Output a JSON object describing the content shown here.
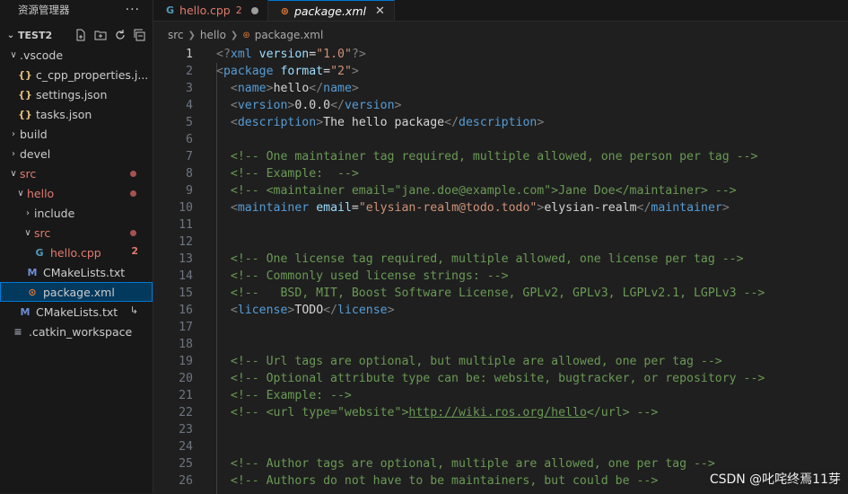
{
  "sidebar": {
    "header_title": "资源管理器",
    "more_label": "···",
    "section_title": "TEST2",
    "tree": [
      {
        "label": "v .vscode",
        "name": ".vscode",
        "type": "folder",
        "open": true,
        "depth": 0
      },
      {
        "label": "c_cpp_properties.j...",
        "type": "json",
        "depth": 1
      },
      {
        "label": "settings.json",
        "type": "json",
        "depth": 1
      },
      {
        "label": "tasks.json",
        "type": "json",
        "depth": 1
      },
      {
        "label": "build",
        "type": "folder",
        "open": false,
        "depth": 0
      },
      {
        "label": "devel",
        "type": "folder",
        "open": false,
        "depth": 0
      },
      {
        "label": "src",
        "type": "folder",
        "open": true,
        "depth": 0,
        "dot": true,
        "red": true
      },
      {
        "label": "hello",
        "type": "folder",
        "open": true,
        "depth": 1,
        "dot": true,
        "red": true
      },
      {
        "label": "include",
        "type": "folder",
        "open": false,
        "depth": 2
      },
      {
        "label": "src",
        "type": "folder",
        "open": true,
        "depth": 2,
        "dot": true,
        "red": true
      },
      {
        "label": "hello.cpp",
        "type": "cpp",
        "depth": 3,
        "badge": "2",
        "red": true
      },
      {
        "label": "CMakeLists.txt",
        "type": "cmake",
        "depth": 2
      },
      {
        "label": "package.xml",
        "type": "xml",
        "depth": 2,
        "selected": true
      },
      {
        "label": "CMakeLists.txt",
        "type": "cmake",
        "depth": 1,
        "link": "↳"
      },
      {
        "label": ".catkin_workspace",
        "type": "list",
        "depth": 0
      }
    ]
  },
  "tabs": [
    {
      "label": "hello.cpp",
      "icon": "G",
      "count": "2",
      "active": false,
      "dirty": true
    },
    {
      "label": "package.xml",
      "icon": "х",
      "active": true
    }
  ],
  "breadcrumb": [
    "src",
    "hello",
    "package.xml"
  ],
  "editor": {
    "current_line": 1,
    "lines": [
      {
        "n": "1",
        "tokens": [
          [
            "brk",
            "<?"
          ],
          [
            "tag",
            "xml"
          ],
          [
            "txt",
            " "
          ],
          [
            "attr",
            "version"
          ],
          [
            "txt",
            "="
          ],
          [
            "str",
            "\"1.0\""
          ],
          [
            "brk",
            "?>"
          ]
        ]
      },
      {
        "n": "2",
        "tokens": [
          [
            "brk",
            "<"
          ],
          [
            "tag",
            "package"
          ],
          [
            "txt",
            " "
          ],
          [
            "attr",
            "format"
          ],
          [
            "txt",
            "="
          ],
          [
            "str",
            "\"2\""
          ],
          [
            "brk",
            ">"
          ]
        ]
      },
      {
        "n": "3",
        "tokens": [
          [
            "txt",
            "  "
          ],
          [
            "brk",
            "<"
          ],
          [
            "tag",
            "name"
          ],
          [
            "brk",
            ">"
          ],
          [
            "txt",
            "hello"
          ],
          [
            "brk",
            "</"
          ],
          [
            "tag",
            "name"
          ],
          [
            "brk",
            ">"
          ]
        ]
      },
      {
        "n": "4",
        "tokens": [
          [
            "txt",
            "  "
          ],
          [
            "brk",
            "<"
          ],
          [
            "tag",
            "version"
          ],
          [
            "brk",
            ">"
          ],
          [
            "txt",
            "0.0.0"
          ],
          [
            "brk",
            "</"
          ],
          [
            "tag",
            "version"
          ],
          [
            "brk",
            ">"
          ]
        ]
      },
      {
        "n": "5",
        "tokens": [
          [
            "txt",
            "  "
          ],
          [
            "brk",
            "<"
          ],
          [
            "tag",
            "description"
          ],
          [
            "brk",
            ">"
          ],
          [
            "txt",
            "The hello package"
          ],
          [
            "brk",
            "</"
          ],
          [
            "tag",
            "description"
          ],
          [
            "brk",
            ">"
          ]
        ]
      },
      {
        "n": "6",
        "tokens": []
      },
      {
        "n": "7",
        "tokens": [
          [
            "txt",
            "  "
          ],
          [
            "com",
            "<!-- One maintainer tag required, multiple allowed, one person per tag -->"
          ]
        ]
      },
      {
        "n": "8",
        "tokens": [
          [
            "txt",
            "  "
          ],
          [
            "com",
            "<!-- Example:  -->"
          ]
        ]
      },
      {
        "n": "9",
        "tokens": [
          [
            "txt",
            "  "
          ],
          [
            "com",
            "<!-- <maintainer email=\"jane.doe@example.com\">Jane Doe</maintainer> -->"
          ]
        ]
      },
      {
        "n": "10",
        "tokens": [
          [
            "txt",
            "  "
          ],
          [
            "brk",
            "<"
          ],
          [
            "tag",
            "maintainer"
          ],
          [
            "txt",
            " "
          ],
          [
            "attr",
            "email"
          ],
          [
            "txt",
            "="
          ],
          [
            "str",
            "\"elysian-realm@todo.todo\""
          ],
          [
            "brk",
            ">"
          ],
          [
            "txt",
            "elysian-realm"
          ],
          [
            "brk",
            "</"
          ],
          [
            "tag",
            "maintainer"
          ],
          [
            "brk",
            ">"
          ]
        ]
      },
      {
        "n": "11",
        "tokens": []
      },
      {
        "n": "12",
        "tokens": []
      },
      {
        "n": "13",
        "tokens": [
          [
            "txt",
            "  "
          ],
          [
            "com",
            "<!-- One license tag required, multiple allowed, one license per tag -->"
          ]
        ]
      },
      {
        "n": "14",
        "tokens": [
          [
            "txt",
            "  "
          ],
          [
            "com",
            "<!-- Commonly used license strings: -->"
          ]
        ]
      },
      {
        "n": "15",
        "tokens": [
          [
            "txt",
            "  "
          ],
          [
            "com",
            "<!--   BSD, MIT, Boost Software License, GPLv2, GPLv3, LGPLv2.1, LGPLv3 -->"
          ]
        ]
      },
      {
        "n": "16",
        "tokens": [
          [
            "txt",
            "  "
          ],
          [
            "brk",
            "<"
          ],
          [
            "tag",
            "license"
          ],
          [
            "brk",
            ">"
          ],
          [
            "txt",
            "TODO"
          ],
          [
            "brk",
            "</"
          ],
          [
            "tag",
            "license"
          ],
          [
            "brk",
            ">"
          ]
        ]
      },
      {
        "n": "17",
        "tokens": []
      },
      {
        "n": "18",
        "tokens": []
      },
      {
        "n": "19",
        "tokens": [
          [
            "txt",
            "  "
          ],
          [
            "com",
            "<!-- Url tags are optional, but multiple are allowed, one per tag -->"
          ]
        ]
      },
      {
        "n": "20",
        "tokens": [
          [
            "txt",
            "  "
          ],
          [
            "com",
            "<!-- Optional attribute type can be: website, bugtracker, or repository -->"
          ]
        ]
      },
      {
        "n": "21",
        "tokens": [
          [
            "txt",
            "  "
          ],
          [
            "com",
            "<!-- Example: -->"
          ]
        ]
      },
      {
        "n": "22",
        "tokens": [
          [
            "txt",
            "  "
          ],
          [
            "com",
            "<!-- <url type=\"website\">"
          ],
          [
            "url",
            "http://wiki.ros.org/hello"
          ],
          [
            "com",
            "</url> -->"
          ]
        ]
      },
      {
        "n": "23",
        "tokens": []
      },
      {
        "n": "24",
        "tokens": []
      },
      {
        "n": "25",
        "tokens": [
          [
            "txt",
            "  "
          ],
          [
            "com",
            "<!-- Author tags are optional, multiple are allowed, one per tag -->"
          ]
        ]
      },
      {
        "n": "26",
        "tokens": [
          [
            "txt",
            "  "
          ],
          [
            "com",
            "<!-- Authors do not have to be maintainers, but could be -->"
          ]
        ]
      }
    ]
  },
  "watermark": "CSDN @叱咤终焉11芽"
}
